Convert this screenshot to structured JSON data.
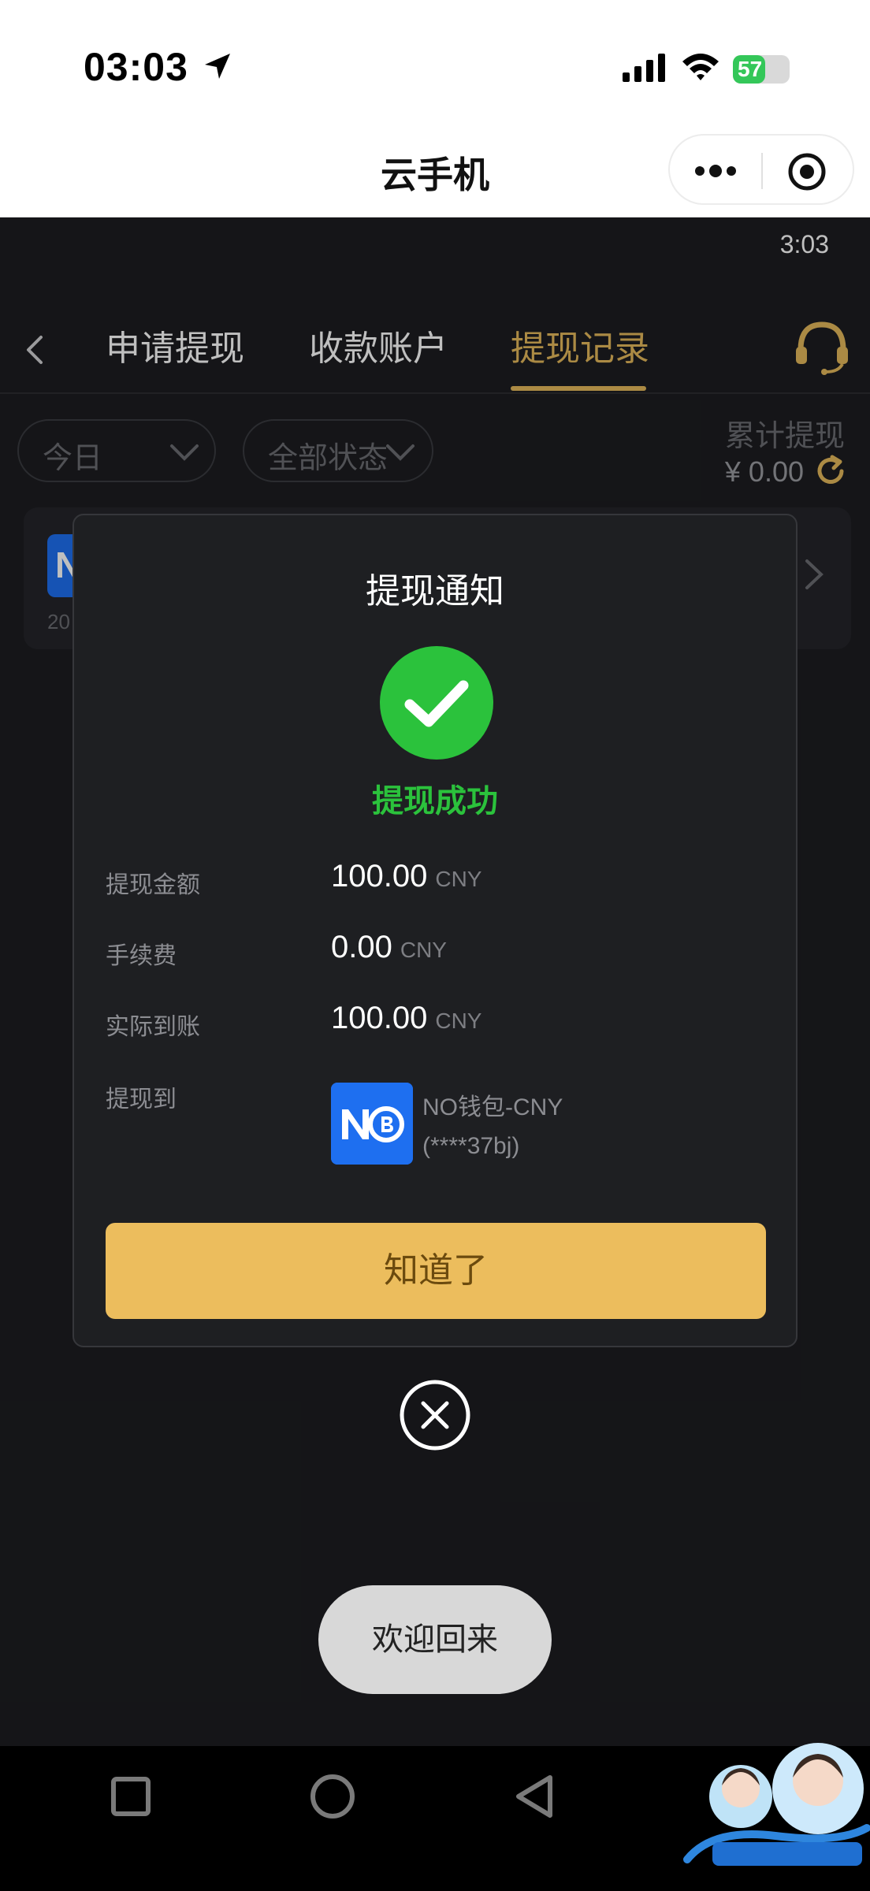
{
  "status_bar": {
    "time": "03:03",
    "battery": "57",
    "battery_level": 0.57
  },
  "mini_program": {
    "title": "云手机"
  },
  "app": {
    "clock": "3:03",
    "tabs": [
      {
        "label": "申请提现",
        "active": false
      },
      {
        "label": "收款账户",
        "active": false
      },
      {
        "label": "提现记录",
        "active": true
      }
    ],
    "filters": {
      "date": "今日",
      "status": "全部状态"
    },
    "total": {
      "label": "累计提现",
      "value": "¥ 0.00"
    },
    "record": {
      "logo_text": "N",
      "date_prefix": "20"
    }
  },
  "modal": {
    "title": "提现通知",
    "result": "提现成功",
    "rows": [
      {
        "label": "提现金额",
        "value": "100.00",
        "unit": "CNY"
      },
      {
        "label": "手续费",
        "value": "0.00",
        "unit": "CNY"
      },
      {
        "label": "实际到账",
        "value": "100.00",
        "unit": "CNY"
      }
    ],
    "destination_label": "提现到",
    "wallet_name": "NO钱包-CNY",
    "wallet_account": "(****37bj)",
    "confirm_label": "知道了"
  },
  "toast": "欢迎回来",
  "colors": {
    "accent": "#e4b95b",
    "success": "#2bc23c",
    "button": "#ecbd5d",
    "wallet_blue": "#1e6ff0"
  }
}
